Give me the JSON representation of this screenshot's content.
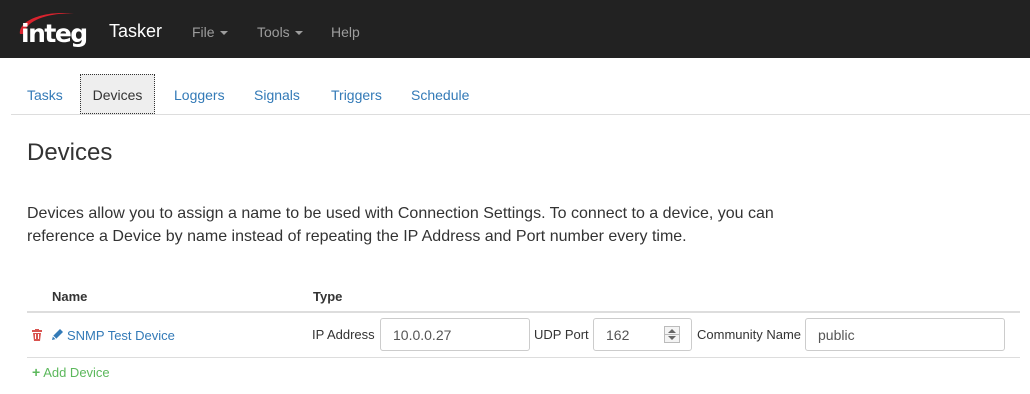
{
  "navbar": {
    "brand": "integ",
    "title": "Tasker",
    "menus": [
      {
        "label": "File"
      },
      {
        "label": "Tools"
      },
      {
        "label": "Help"
      }
    ]
  },
  "tabs": [
    {
      "label": "Tasks"
    },
    {
      "label": "Devices",
      "active": true
    },
    {
      "label": "Loggers"
    },
    {
      "label": "Signals"
    },
    {
      "label": "Triggers"
    },
    {
      "label": "Schedule"
    }
  ],
  "page": {
    "title": "Devices",
    "description": "Devices allow you to assign a name to be used with Connection Settings. To connect to a device, you can reference a Device by name instead of repeating the IP Address and Port number every time."
  },
  "table": {
    "headers": {
      "name": "Name",
      "type": "Type"
    },
    "rows": [
      {
        "name": "SNMP Test Device",
        "ip_label": "IP Address",
        "ip_value": "10.0.0.27",
        "port_label": "UDP Port",
        "port_value": "162",
        "community_label": "Community Name",
        "community_value": "public"
      }
    ],
    "add_label": "Add Device"
  },
  "colors": {
    "navbar": "#222222",
    "link": "#337ab7",
    "danger": "#d9534f",
    "success": "#5cb85c",
    "logo_swoosh": "#d9232e"
  },
  "icons": {
    "delete": "trash-icon",
    "edit": "pencil-icon",
    "add": "plus-icon"
  }
}
